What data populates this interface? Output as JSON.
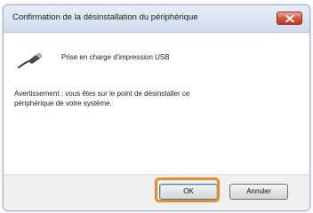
{
  "window": {
    "title": "Confirmation de la désinstallation du périphérique"
  },
  "device": {
    "name": "Prise en charge d'impression USB",
    "icon": "usb-cable-icon"
  },
  "message": {
    "warning": "Avertissement : vous êtes sur le point de désinstaller ce périphérique de votre système."
  },
  "buttons": {
    "ok_label": "OK",
    "cancel_label": "Annuler"
  },
  "colors": {
    "highlight": "#f08a1c",
    "close_button": "#d2523b"
  }
}
